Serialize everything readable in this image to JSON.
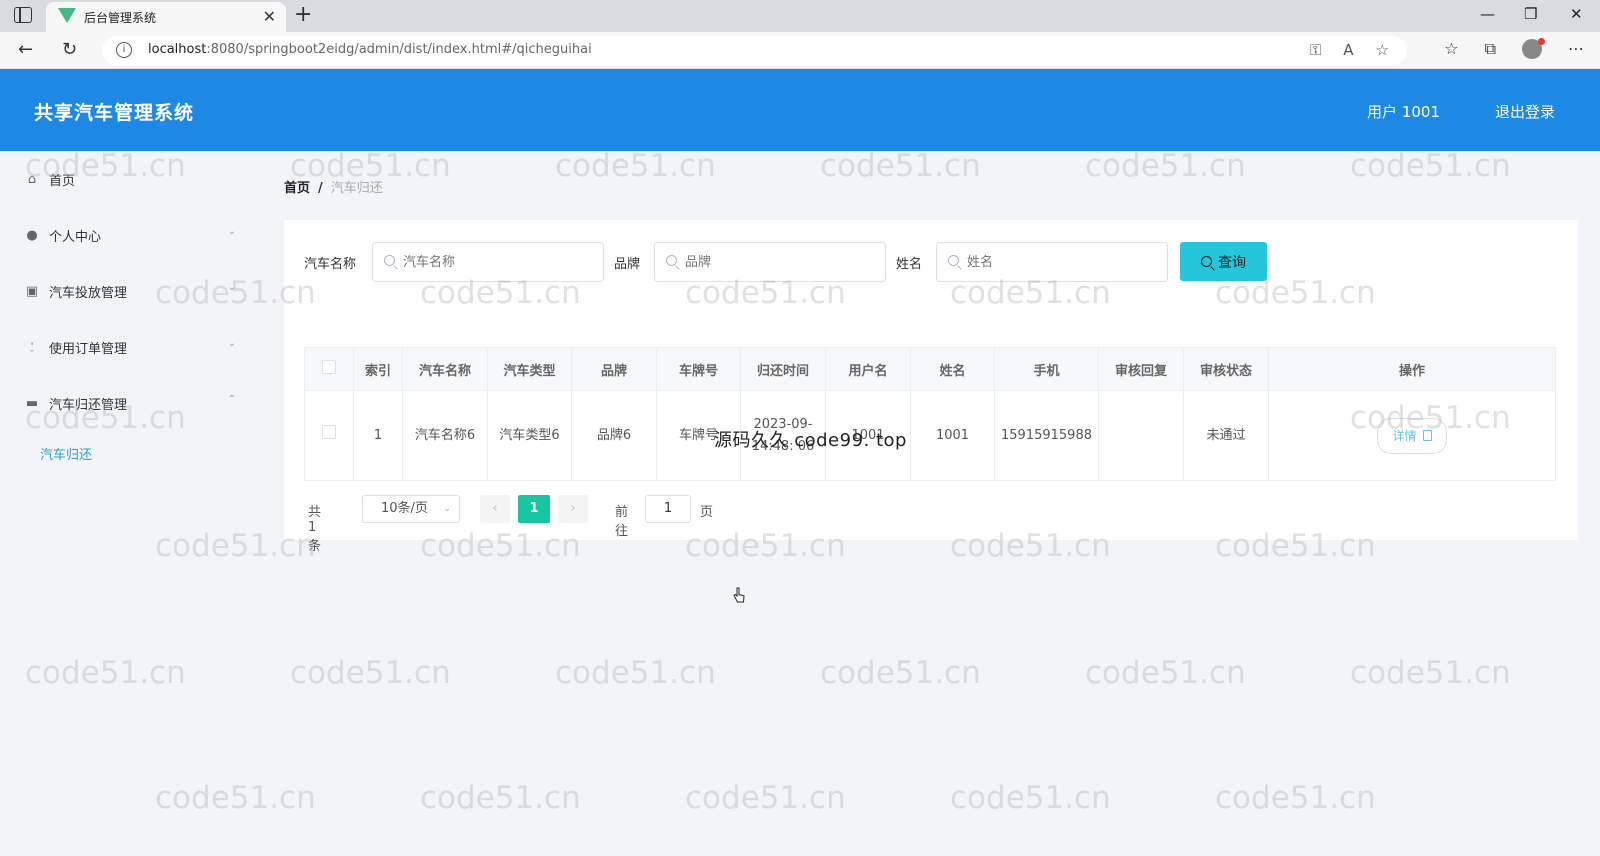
{
  "browser": {
    "tab_title": "后台管理系统",
    "url_host": "localhost",
    "url_rest": ":8080/springboot2eidg/admin/dist/index.html#/qicheguihai"
  },
  "header": {
    "app_title": "共享汽车管理系统",
    "user_label": "用户 1001",
    "logout_label": "退出登录",
    "bg_color": "#1e88e5"
  },
  "sidebar": {
    "items": [
      {
        "label": "首页",
        "icon": "home-icon"
      },
      {
        "label": "个人中心",
        "icon": "user-icon"
      },
      {
        "label": "汽车投放管理",
        "icon": "clipboard-icon"
      },
      {
        "label": "使用订单管理",
        "icon": "microphone-icon"
      },
      {
        "label": "汽车归还管理",
        "icon": "kiosk-icon"
      }
    ],
    "submenu_label": "汽车归还"
  },
  "breadcrumb": {
    "home": "首页",
    "separator": "/",
    "current": "汽车归还"
  },
  "search": {
    "car_name_label": "汽车名称",
    "car_name_placeholder": "汽车名称",
    "brand_label": "品牌",
    "brand_placeholder": "品牌",
    "name_label": "姓名",
    "name_placeholder": "姓名",
    "query_label": "查询",
    "query_color": "#26c6da"
  },
  "table": {
    "headers": [
      "索引",
      "汽车名称",
      "汽车类型",
      "品牌",
      "车牌号",
      "归还时间",
      "用户名",
      "姓名",
      "手机",
      "审核回复",
      "审核状态",
      "操作"
    ],
    "rows": [
      {
        "index": "1",
        "car_name": "汽车名称6",
        "car_type": "汽车类型6",
        "brand": "品牌6",
        "plate": "车牌号",
        "return_time": "2023-09- 14:48: 06",
        "username": "1001",
        "name": "1001",
        "phone": "15915915988",
        "review_reply": "",
        "review_status": "未通过",
        "action_label": "详情"
      }
    ]
  },
  "pagination": {
    "total": "共 1 条",
    "page_size": "10条/页",
    "prev": "‹",
    "current_page": "1",
    "next": "›",
    "goto_label": "前往",
    "goto_value": "1",
    "goto_suffix": "页",
    "active_color": "#17c5a0"
  },
  "watermarks": {
    "site": "code51.cn",
    "center_overlay": "源码久久 code99. top"
  }
}
